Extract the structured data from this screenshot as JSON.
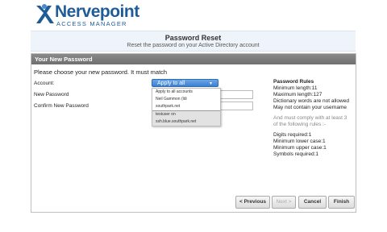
{
  "brand": {
    "name": "Nervepoint",
    "subtitle": "ACCESS MANAGER"
  },
  "header": {
    "title": "Password Reset",
    "subtitle": "Reset the password on your Active Directory account"
  },
  "panel": {
    "title": "Your New Password",
    "intro": "Please choose your new password. It must match",
    "account_label": "Account:",
    "new_password_label": "New Password",
    "confirm_password_label": "Confirm New Password"
  },
  "account_select": {
    "selected": "Apply to all",
    "options": [
      "Apply to all accounts",
      "Neil Gammon (ldi",
      "southpark.net",
      "testuser on",
      "ssh.blue.southpark.net"
    ]
  },
  "rules": {
    "heading": "Password Rules",
    "min_length": "Minimum length:11",
    "max_length": "Maximum length:127",
    "dictionary": "Dictionary words are not allowed",
    "username": "May not contain your username",
    "comply1": "And must comply with at least 3",
    "comply2": "of the following rules :-",
    "digits": "Digits required:1",
    "lower": "Minimum lower case:1",
    "upper": "Minimum upper case:1",
    "symbols": "Symbols required:1"
  },
  "buttons": {
    "previous": "< Previous",
    "next": "Next >",
    "cancel": "Cancel",
    "finish": "Finish"
  },
  "colors": {
    "brand_blue": "#1f5d98",
    "select_blue": "#3f7fd0"
  }
}
